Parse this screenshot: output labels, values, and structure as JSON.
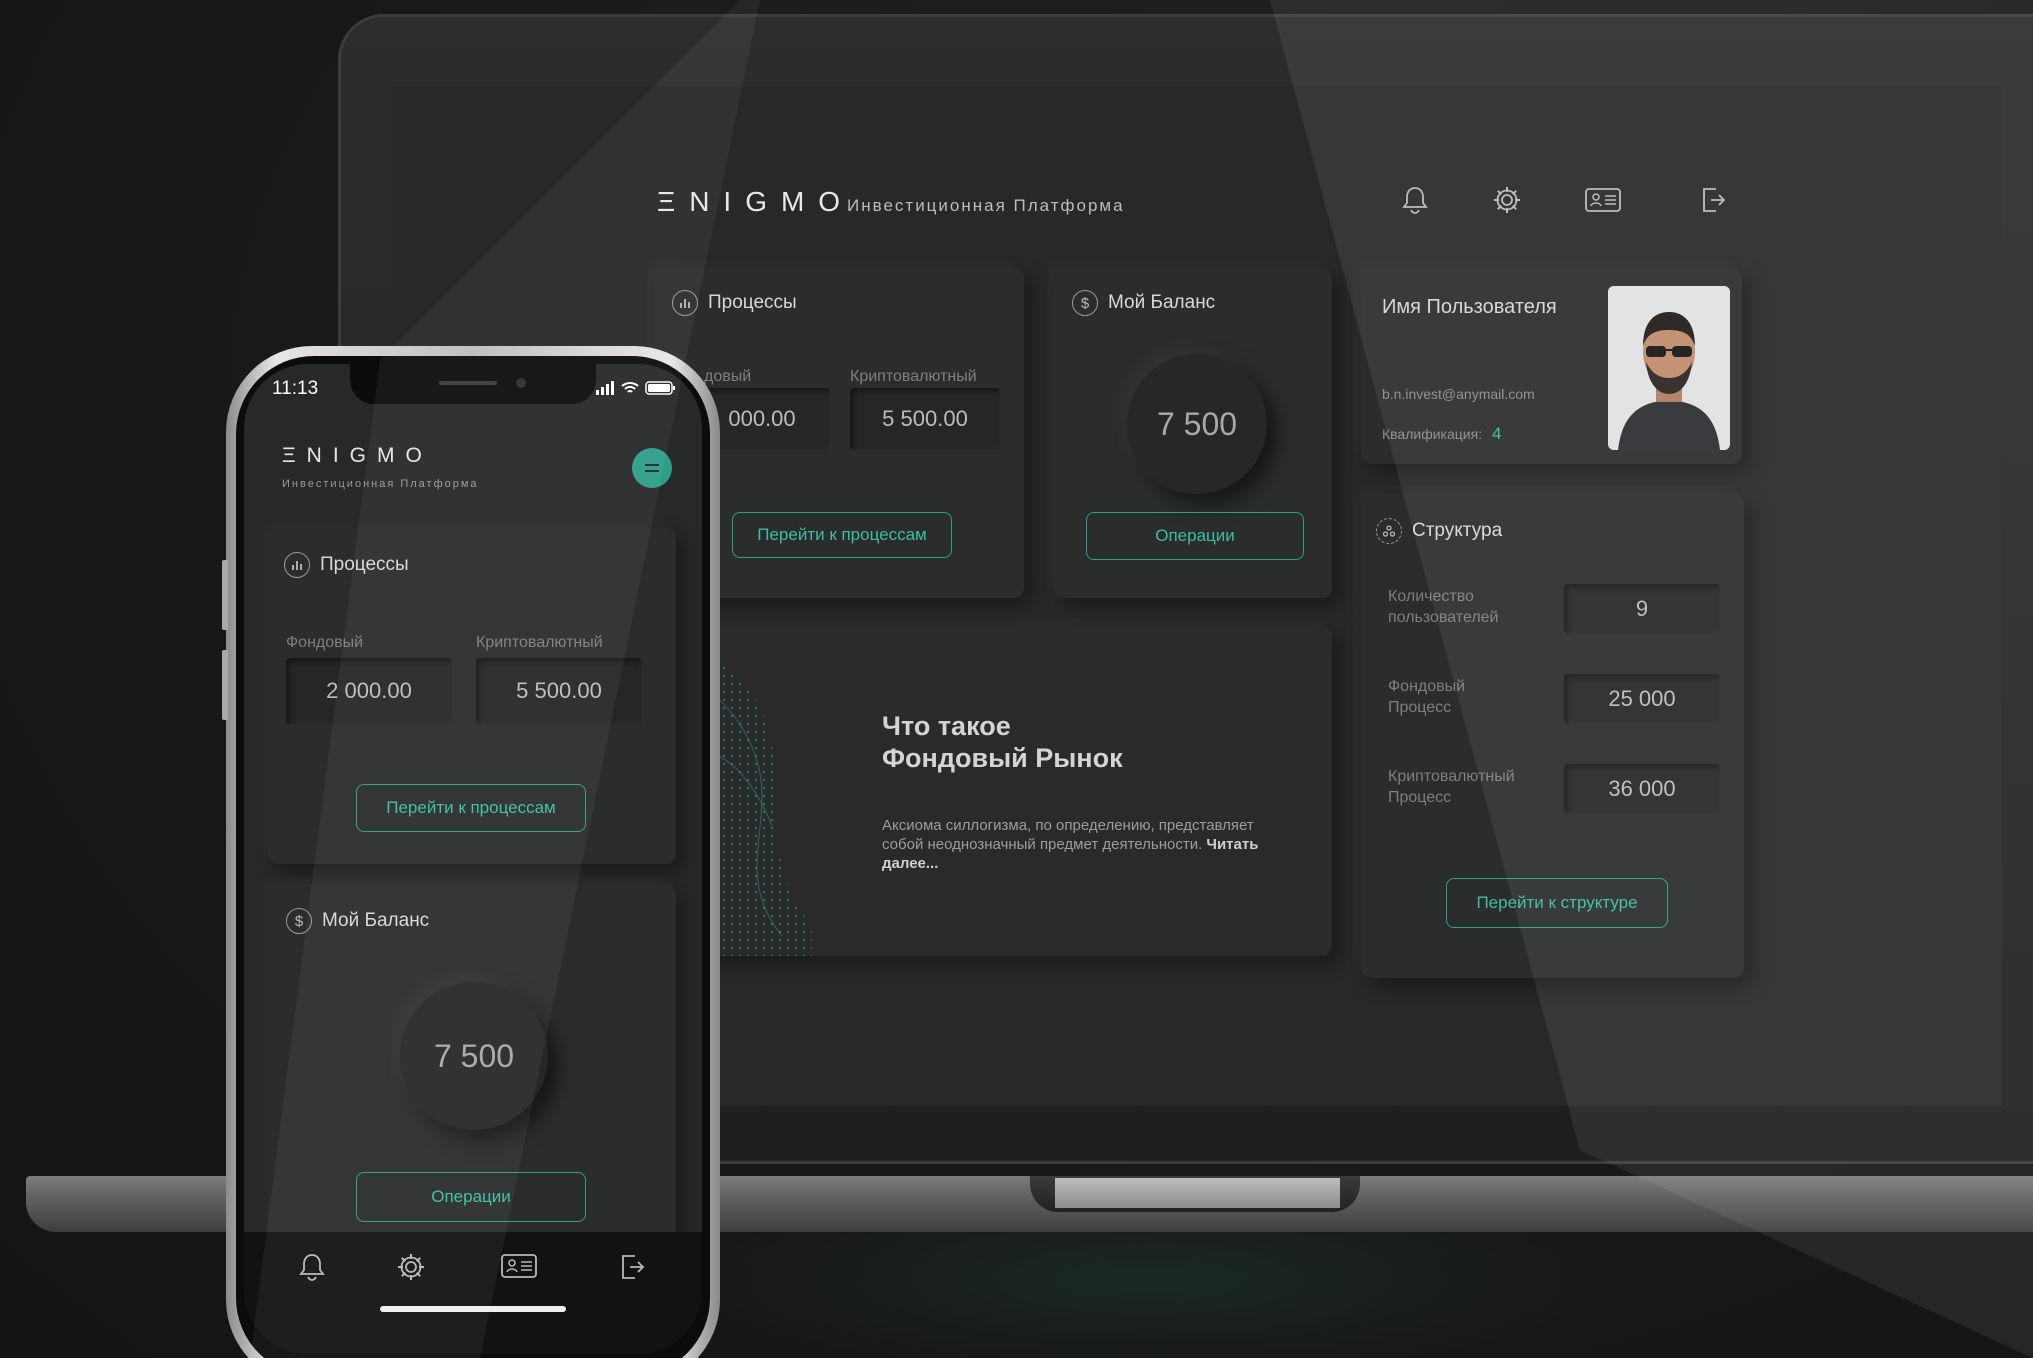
{
  "brand": {
    "logo": "ΞNIGMO",
    "tagline": "Инвестиционная Платформа"
  },
  "colors": {
    "accent": "#3bbfa4",
    "background": "#262829",
    "card": "#2a2c2d"
  },
  "header_icons": [
    "bell-icon",
    "gear-icon",
    "id-card-icon",
    "logout-icon"
  ],
  "processes": {
    "title": "Процессы",
    "stock_label": "Фондовый",
    "crypto_label": "Криптовалютный",
    "desktop_stock_label_partial": "довый",
    "desktop_stock_value_partial": "000.00",
    "stock_value": "2 000.00",
    "crypto_value": "5 500.00",
    "button": "Перейти к процессам"
  },
  "balance": {
    "title": "Мой Баланс",
    "value": "7 500",
    "button": "Операции"
  },
  "profile": {
    "name": "Имя Пользователя",
    "email": "b.n.invest@anymail.com",
    "qualification_label": "Квалификация:",
    "qualification_value": "4"
  },
  "structure": {
    "title": "Структура",
    "rows": [
      {
        "label": "Количество пользователей",
        "value": "9"
      },
      {
        "label": "Фондовый Процесс",
        "value": "25 000"
      },
      {
        "label": "Криптовалютный Процесс",
        "value": "36 000"
      }
    ],
    "button": "Перейти к структуре"
  },
  "article": {
    "title_line1": "Что такое",
    "title_line2": "Фондовый Рынок",
    "body": "Аксиома силлогизма, по определению, представляет собой неоднозначный предмет деятельности.",
    "read_more": "Читать далее..."
  },
  "phone": {
    "time": "11:13",
    "menu_icon": "menu-icon"
  }
}
